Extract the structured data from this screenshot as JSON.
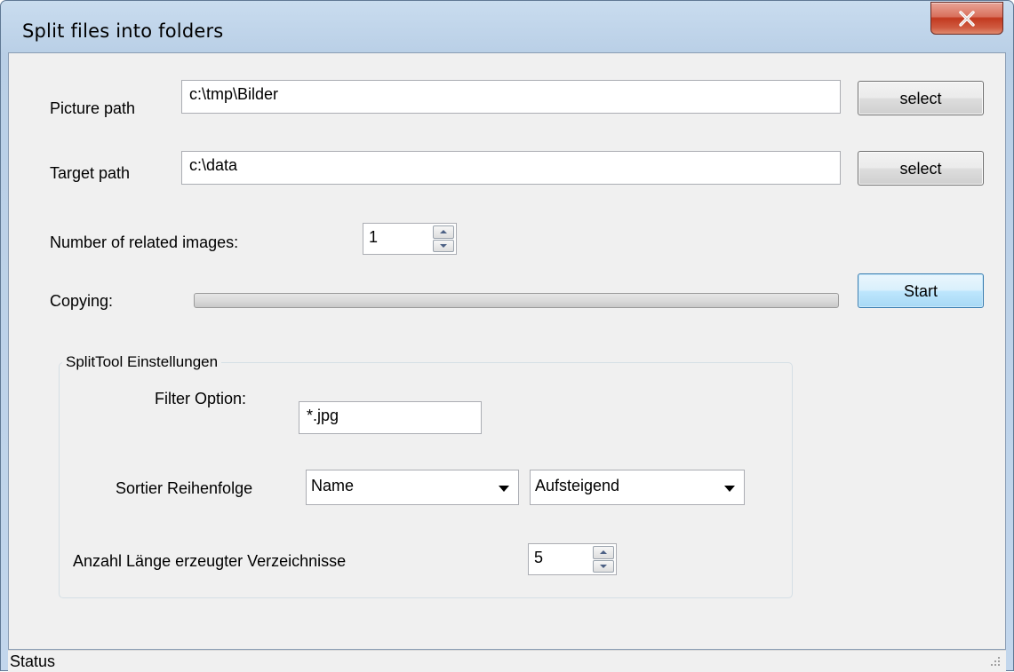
{
  "window": {
    "title": "Split files into folders",
    "close_label": "X"
  },
  "picture_path": {
    "label": "Picture path",
    "value": "c:\\tmp\\Bilder",
    "button": "select"
  },
  "target_path": {
    "label": "Target path",
    "value": "c:\\data",
    "button": "select"
  },
  "related_images": {
    "label": "Number of related images:",
    "value": "1"
  },
  "copying": {
    "label": "Copying:",
    "progress": 0,
    "start_button": "Start"
  },
  "settings": {
    "group_title": "SplitTool Einstellungen",
    "filter_label": "Filter Option:",
    "filter_value": "*.jpg",
    "sort_label": "Sortier Reihenfolge",
    "sort_field": "Name",
    "sort_direction": "Aufsteigend",
    "dir_length_label": "Anzahl Länge erzeugter Verzeichnisse",
    "dir_length_value": "5"
  },
  "status": {
    "text": "Status"
  },
  "icons": {
    "close": "close-icon",
    "spin_up": "spin-up-icon",
    "spin_down": "spin-down-icon",
    "dropdown": "chevron-down-icon",
    "grip": "resize-grip-icon"
  },
  "colors": {
    "frame": "#c2d6ec",
    "client": "#f0f0f0",
    "close_button": "#c2391f",
    "default_button_border": "#3c7fb1"
  }
}
